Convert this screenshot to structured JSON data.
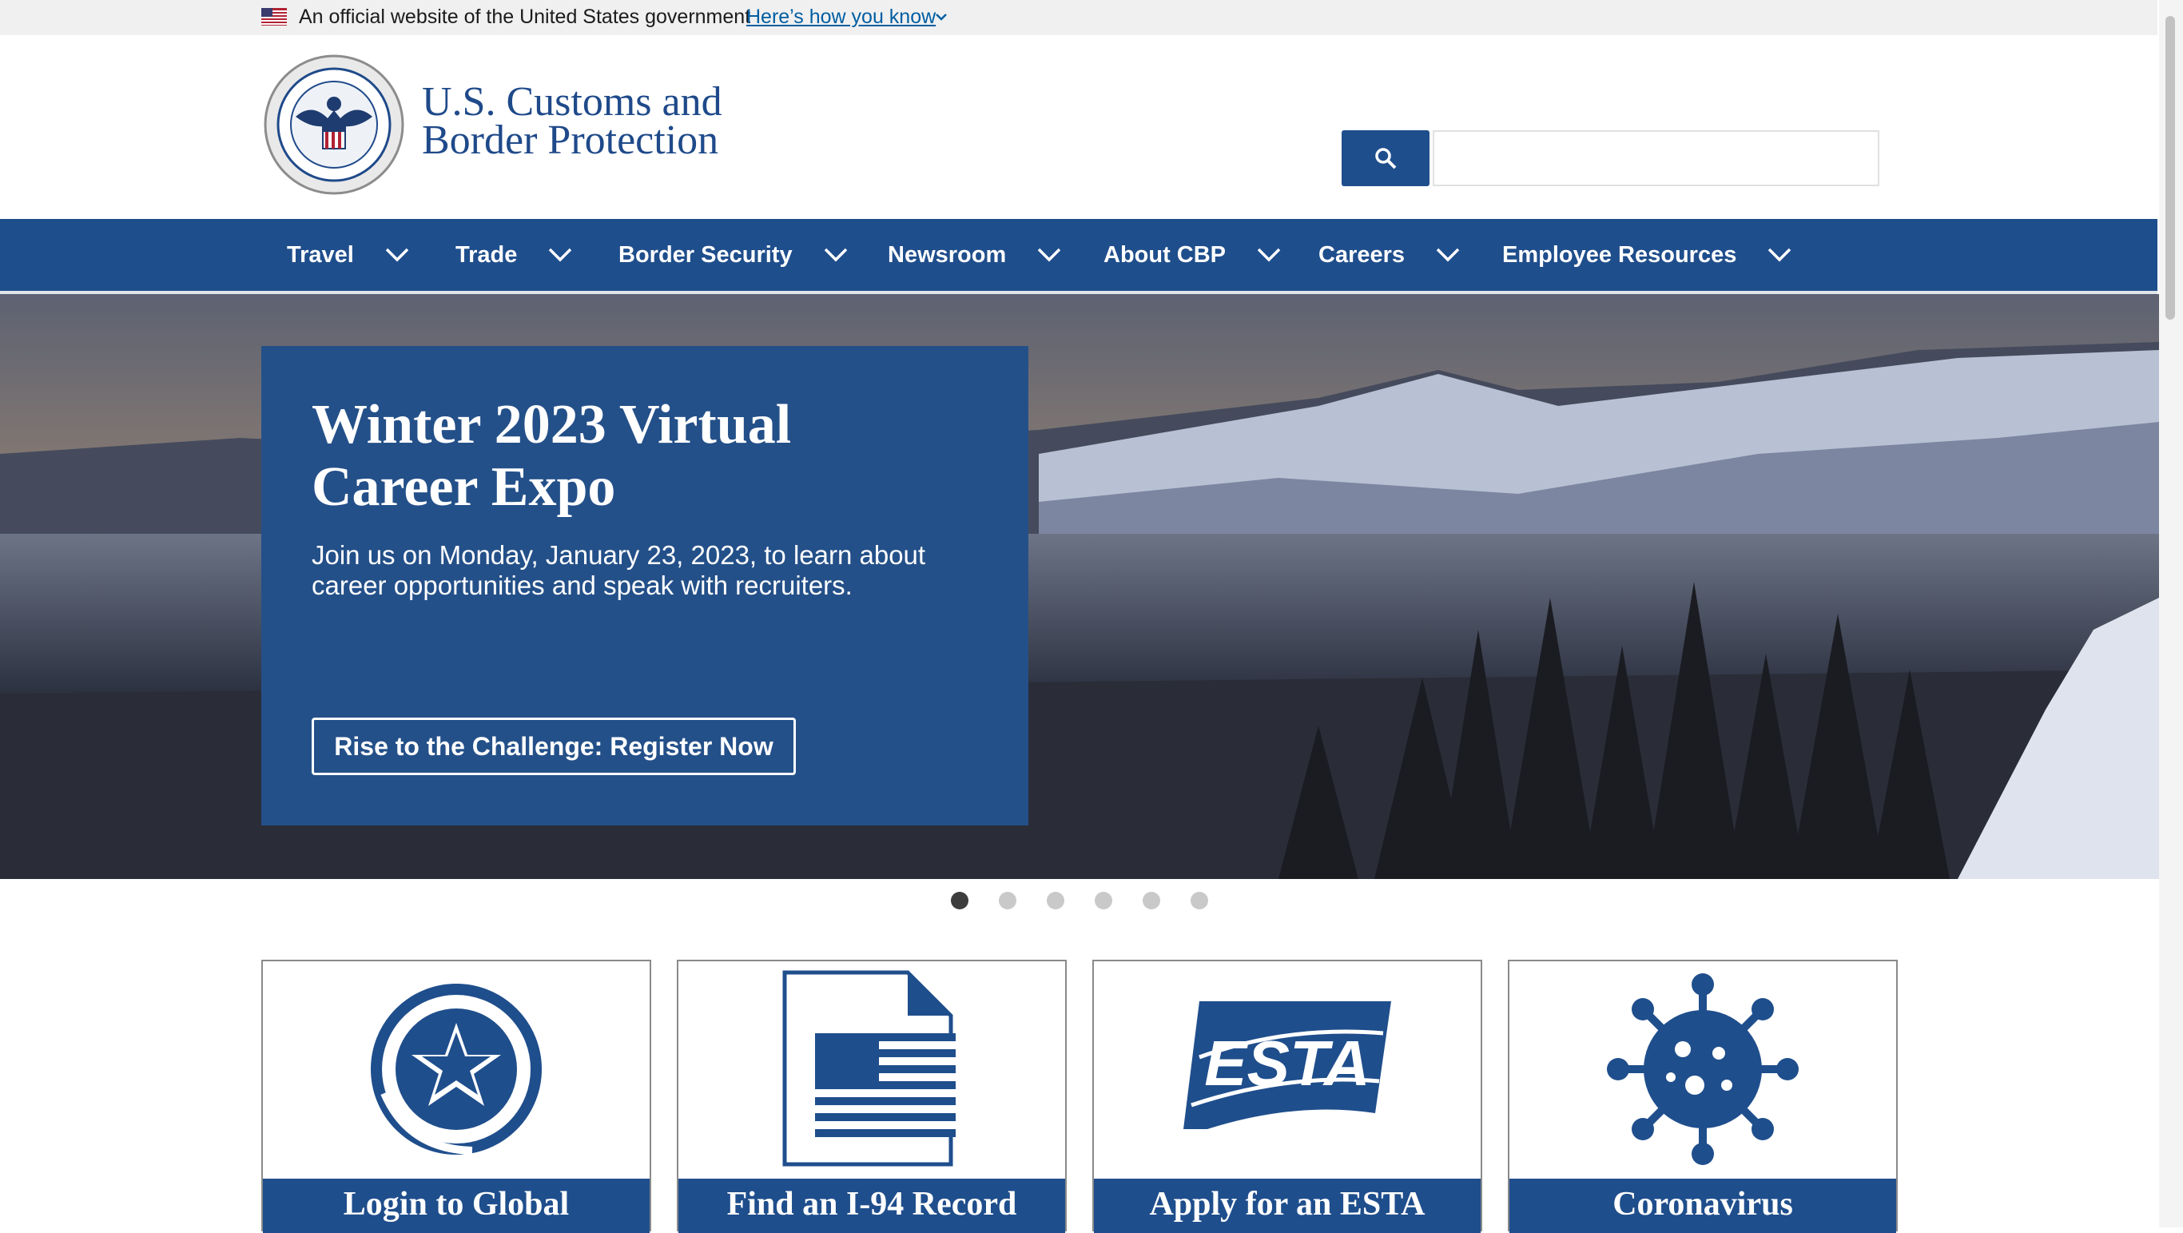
{
  "gov_banner": {
    "official_text": "An official website of the United States government",
    "how_link": "Here’s how you know"
  },
  "header": {
    "brand_line1": "U.S. Customs and",
    "brand_line2": "Border Protection",
    "search_placeholder": ""
  },
  "nav": {
    "items": [
      {
        "label": "Travel"
      },
      {
        "label": "Trade"
      },
      {
        "label": "Border Security"
      },
      {
        "label": "Newsroom"
      },
      {
        "label": "About CBP"
      },
      {
        "label": "Careers"
      },
      {
        "label": "Employee Resources"
      }
    ]
  },
  "hero": {
    "title": "Winter 2023 Virtual Career Expo",
    "text": "Join us on Monday, January 23, 2023, to learn about career opportunities and speak with recruiters.",
    "cta": "Rise to the Challenge: Register Now",
    "slide_count": 6,
    "active_slide": 1
  },
  "cards": [
    {
      "label": "Login to Global",
      "icon": "global-entry-icon"
    },
    {
      "label": "Find an I-94 Record",
      "icon": "i94-document-icon"
    },
    {
      "label": "Apply for an ESTA",
      "icon": "esta-icon"
    },
    {
      "label": "Coronavirus",
      "icon": "virus-icon"
    }
  ],
  "colors": {
    "primary": "#1f4e8c",
    "hero_card": "#245089",
    "banner_bg": "#f0f0f0",
    "link": "#005ea2"
  }
}
